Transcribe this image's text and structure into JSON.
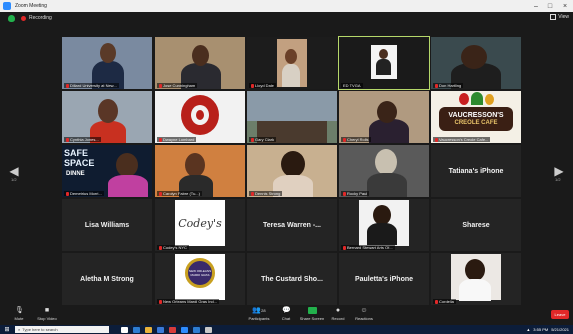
{
  "window": {
    "title": "Zoom Meeting"
  },
  "top": {
    "recording_label": "Recording",
    "view_label": "View"
  },
  "tiles": [
    {
      "name": "Dillard University at New..."
    },
    {
      "name": "Jose Cunningham"
    },
    {
      "name": "Lloyd Dale"
    },
    {
      "name": "ED TVGA"
    },
    {
      "name": "Don Hartling"
    },
    {
      "name": "Cynthia Jones..."
    },
    {
      "name": "Dwayne Lombard"
    },
    {
      "name": "Gary Clark"
    },
    {
      "name": "Cheryl Rolls"
    },
    {
      "name": "Vaucresson's Creole Cafe..."
    },
    {
      "name": "Demetrius Morri..."
    },
    {
      "name": "Carolyn Fabre (Tu...)"
    },
    {
      "name": "Dennis Strong"
    },
    {
      "name": "Rocky Paul"
    },
    {
      "center": "Tatiana's iPhone"
    },
    {
      "center": "Lisa Williams"
    },
    {
      "name": "Codey's NYC"
    },
    {
      "center": "Teresa Warren -..."
    },
    {
      "name": "Bernard Stewart Arts Of..."
    },
    {
      "center": "Sharese"
    },
    {
      "center": "Aletha M Strong"
    },
    {
      "name": "New Orleans Mardi Gras Ind..."
    },
    {
      "center": "The Custard Sho..."
    },
    {
      "center": "Pauletta's iPhone"
    },
    {
      "name": "Cordelia"
    }
  ],
  "logos": {
    "vaucresson_line1": "VAUCRESSON'S",
    "vaucresson_line2": "CREOLE CAFE",
    "safespace_line1": "SAFE",
    "safespace_line2": "SPACE",
    "safespace_line3": "DINNE",
    "codeys": "Codey's",
    "mardi_gras": "NEW ORLEANS MARDI GRAS"
  },
  "nav": {
    "left_page": "1/2",
    "right_page": "1/2"
  },
  "toolbar": {
    "mute": "Mute",
    "stop_video": "Stop Video",
    "participants": "Participants",
    "participants_count": "28",
    "chat": "Chat",
    "share_screen": "Share Screen",
    "record": "Record",
    "reactions": "Reactions",
    "end": "Leave"
  },
  "taskbar": {
    "search_placeholder": "Type here to search",
    "time": "3:55 PM",
    "date": "5/21/2021"
  },
  "colors": {
    "accent": "#2d8cff",
    "active_speaker": "#b5d86a",
    "end": "#e02828",
    "share": "#22b14c"
  }
}
